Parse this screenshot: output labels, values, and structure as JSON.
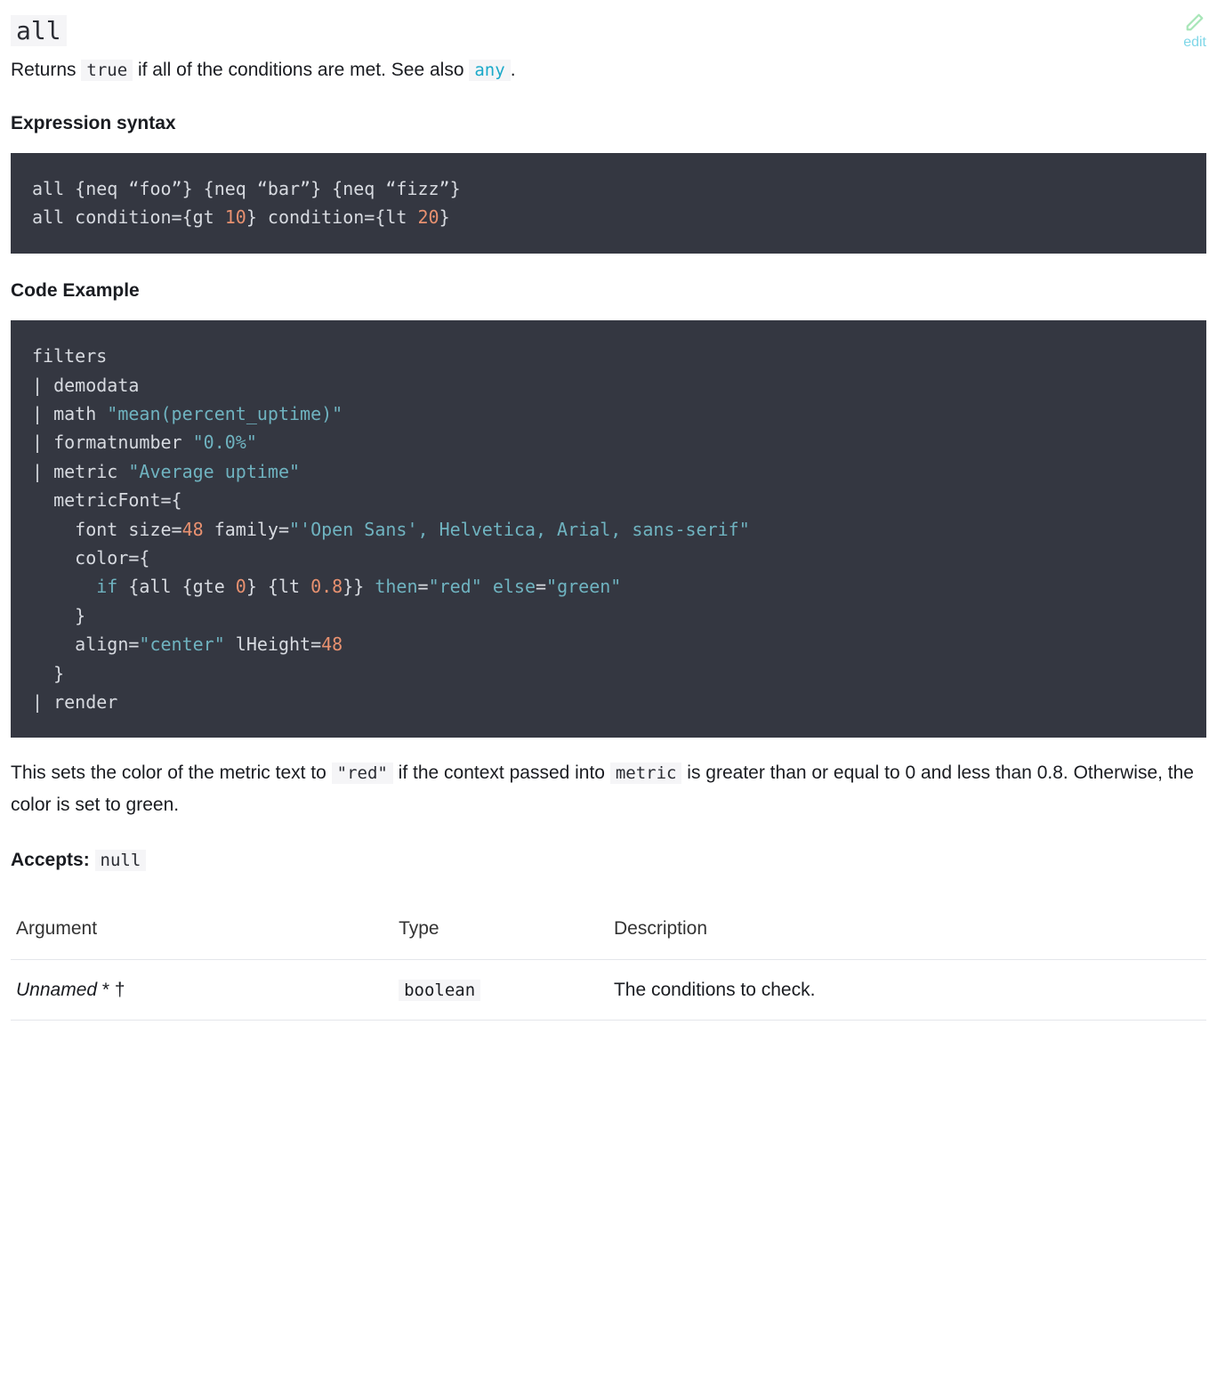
{
  "header": {
    "fn_name": "all",
    "edit_label": "edit"
  },
  "intro": {
    "prefix": "Returns ",
    "code1": "true",
    "mid": " if all of the conditions are met. See also ",
    "link_code": "any",
    "suffix": "."
  },
  "sections": {
    "expression_syntax": "Expression syntax",
    "code_example": "Code Example"
  },
  "code1": {
    "l1_a": "all {neq “foo”} {neq “bar”} {neq “fizz”}",
    "l2_a": "all condition={gt ",
    "l2_n1": "10",
    "l2_b": "} condition={lt ",
    "l2_n2": "20",
    "l2_c": "}"
  },
  "code2": {
    "l1": "filters",
    "l2": "| demodata",
    "l3_a": "| math ",
    "l3_s": "\"mean(percent_uptime)\"",
    "l4_a": "| formatnumber ",
    "l4_s": "\"0.0%\"",
    "l5_a": "| metric ",
    "l5_s": "\"Average uptime\"",
    "l6": "  metricFont={",
    "l7_a": "    font size=",
    "l7_n": "48",
    "l7_b": " family=",
    "l7_s": "\"'Open Sans', Helvetica, Arial, sans-serif\"",
    "l8": "    color={",
    "l9_a": "      ",
    "l9_kw": "if",
    "l9_b": " {all {gte ",
    "l9_n1": "0",
    "l9_c": "} {lt ",
    "l9_n2": "0.8",
    "l9_d": "}} ",
    "l9_attr1": "then",
    "l9_e": "=",
    "l9_s1": "\"red\"",
    "l9_f": " ",
    "l9_attr2": "else",
    "l9_g": "=",
    "l9_s2": "\"green\"",
    "l10": "    }",
    "l11_a": "    align=",
    "l11_s": "\"center\"",
    "l11_b": " lHeight=",
    "l11_n": "48",
    "l12": "  }",
    "l13": "| render"
  },
  "outro": {
    "a": "This sets the color of the metric text to ",
    "code1": "\"red\"",
    "b": " if the context passed into ",
    "code2": "metric",
    "c": " is greater than or equal to 0 and less than 0.8. Otherwise, the color is set to green."
  },
  "accepts": {
    "label": "Accepts:",
    "value": "null"
  },
  "table": {
    "headers": {
      "arg": "Argument",
      "type": "Type",
      "desc": "Description"
    },
    "rows": [
      {
        "arg_name": "Unnamed",
        "arg_marks": " * †",
        "type": "boolean",
        "desc": "The conditions to check."
      }
    ]
  }
}
